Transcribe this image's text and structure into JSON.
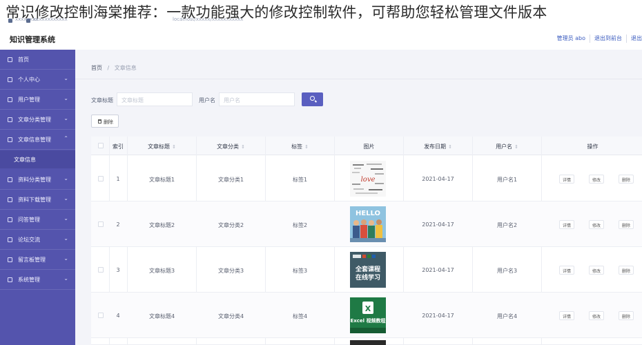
{
  "overlay": {
    "banner_text": "常识修改控制海棠推荐：一款功能强大的修改控制软件，可帮助您轻松管理文件版本"
  },
  "browser": {
    "tab_a": "xxxxxxxx",
    "tab_b": "xxxxxxxxxxxx",
    "url_text": "localhost/xxxxx/xxxxxxxxxxx"
  },
  "header": {
    "brand": "知识管理系统",
    "links": [
      "管理员 abo",
      "退出到前台",
      "退出"
    ]
  },
  "sidebar": {
    "items": [
      {
        "label": "首页",
        "icon": "home-icon",
        "chevron": ""
      },
      {
        "label": "个人中心",
        "icon": "user-icon",
        "chevron": "⌄"
      },
      {
        "label": "用户管理",
        "icon": "users-icon",
        "chevron": "⌄"
      },
      {
        "label": "文章分类管理",
        "icon": "folder-icon",
        "chevron": "⌄"
      },
      {
        "label": "文章信息管理",
        "icon": "doc-icon",
        "chevron": "⌃"
      },
      {
        "label": "资料分类管理",
        "icon": "grid-icon",
        "chevron": "⌄"
      },
      {
        "label": "资料下载管理",
        "icon": "chart-icon",
        "chevron": "⌄"
      },
      {
        "label": "问答管理",
        "icon": "chat-icon",
        "chevron": "⌄"
      },
      {
        "label": "论坛交流",
        "icon": "forum-icon",
        "chevron": "⌄"
      },
      {
        "label": "留言板管理",
        "icon": "message-icon",
        "chevron": "⌄"
      },
      {
        "label": "系统管理",
        "icon": "settings-icon",
        "chevron": "⌄"
      }
    ],
    "sub_item": "文章信息"
  },
  "breadcrumb": {
    "home": "首页",
    "sep": "/",
    "current": "文章信息"
  },
  "filters": {
    "title_label": "文章标题",
    "title_placeholder": "文章标题",
    "user_label": "用户名",
    "user_placeholder": "用户名"
  },
  "toolbar": {
    "delete_label": "删除"
  },
  "table": {
    "headers": [
      "索引",
      "文章标题",
      "文章分类",
      "标签",
      "图片",
      "发布日期",
      "用户名",
      "操作"
    ],
    "rows": [
      {
        "index": "1",
        "title": "文章标题1",
        "category": "文章分类1",
        "tag": "标签1",
        "date": "2021-04-17",
        "user": "用户名1",
        "image": "wordcloud",
        "thumb_text": "love"
      },
      {
        "index": "2",
        "title": "文章标题2",
        "category": "文章分类2",
        "tag": "标签2",
        "date": "2021-04-17",
        "user": "用户名2",
        "image": "people-hello",
        "thumb_text": "HELLO"
      },
      {
        "index": "3",
        "title": "文章标题3",
        "category": "文章分类3",
        "tag": "标签3",
        "date": "2021-04-17",
        "user": "用户名3",
        "image": "office-course",
        "thumb_text": "全套课程\n在线学习"
      },
      {
        "index": "4",
        "title": "文章标题4",
        "category": "文章分类4",
        "tag": "标签4",
        "date": "2021-04-17",
        "user": "用户名4",
        "image": "excel-course",
        "thumb_text": "Excel 视频教程"
      }
    ],
    "actions": [
      "详情",
      "修改",
      "删除"
    ]
  },
  "colors": {
    "sidebar": "#5454ad",
    "accent": "#5a5fc0",
    "link": "#3a5bbf"
  }
}
